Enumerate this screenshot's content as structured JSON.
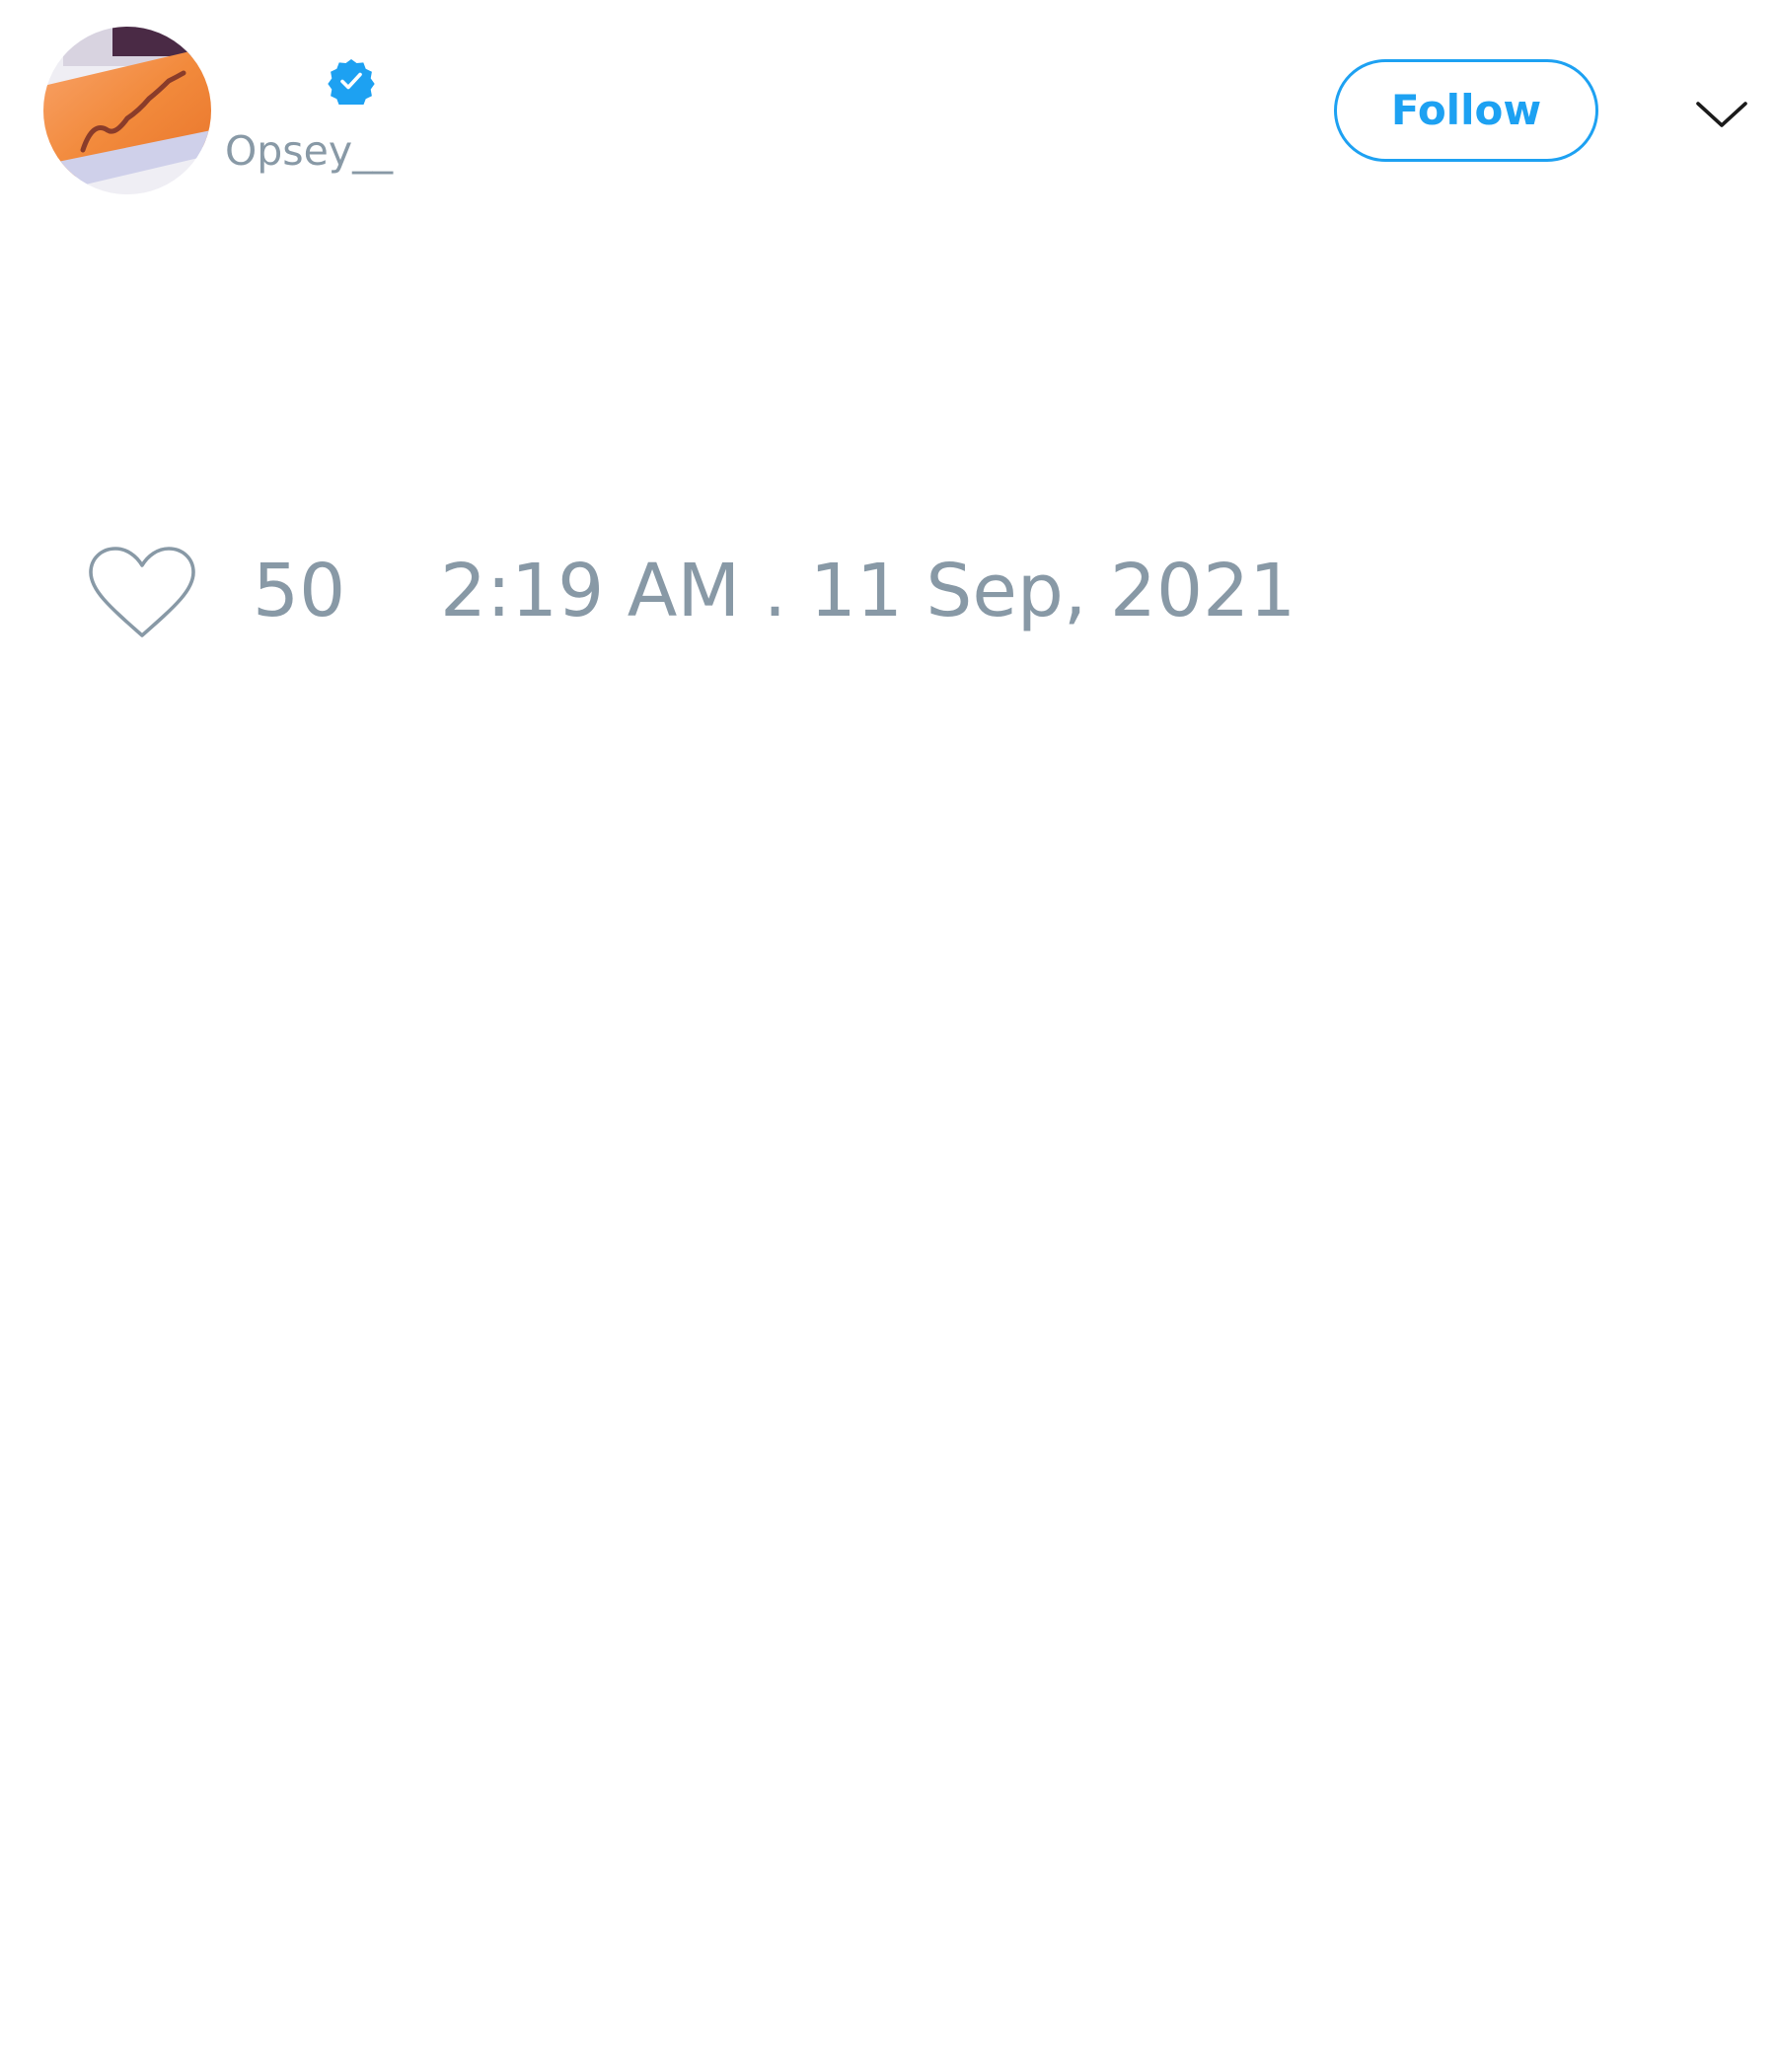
{
  "tweet": {
    "author": {
      "handle": "Opsey__",
      "verified": true,
      "avatar_icon": "profile-photo-orange-object"
    },
    "follow_label": "Follow",
    "menu_icon": "chevron-down-icon",
    "like_icon": "heart-outline-icon",
    "like_count": "50",
    "timestamp": "2:19 AM . 11 Sep, 2021"
  },
  "colors": {
    "accent": "#1da1f2",
    "muted_text": "#8899a6",
    "background": "#ffffff",
    "icon_dark": "#1a1a1a"
  }
}
